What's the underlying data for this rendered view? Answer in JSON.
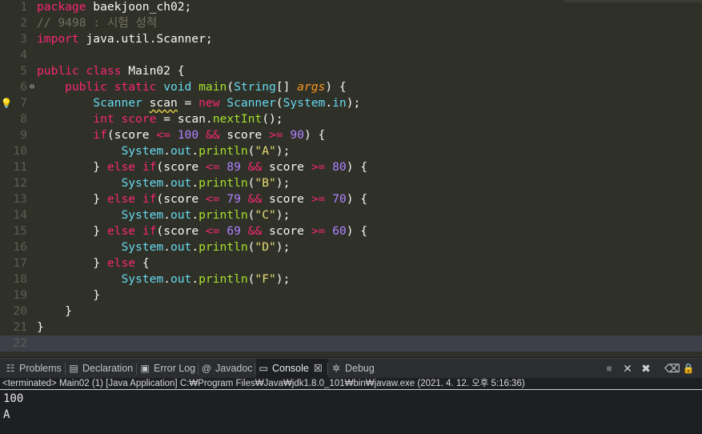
{
  "editor": {
    "lines": [
      [
        {
          "t": "package",
          "c": "kw"
        },
        {
          "t": " baekjoon_ch02;",
          "c": "pl"
        }
      ],
      [
        {
          "t": "// 9498 : 시험 성적",
          "c": "cm"
        }
      ],
      [
        {
          "t": "import",
          "c": "kw"
        },
        {
          "t": " java.util.Scanner;",
          "c": "pl"
        }
      ],
      [],
      [
        {
          "t": "public",
          "c": "kw"
        },
        {
          "t": " ",
          "c": "pl"
        },
        {
          "t": "class",
          "c": "kw"
        },
        {
          "t": " Main02 {",
          "c": "pl"
        }
      ],
      [
        {
          "t": "    ",
          "c": "pl"
        },
        {
          "t": "public",
          "c": "kw"
        },
        {
          "t": " ",
          "c": "pl"
        },
        {
          "t": "static",
          "c": "kw"
        },
        {
          "t": " ",
          "c": "pl"
        },
        {
          "t": "void",
          "c": "ty"
        },
        {
          "t": " ",
          "c": "pl"
        },
        {
          "t": "main",
          "c": "fn"
        },
        {
          "t": "(",
          "c": "pl"
        },
        {
          "t": "String",
          "c": "ty"
        },
        {
          "t": "[] ",
          "c": "pl"
        },
        {
          "t": "args",
          "c": "pa"
        },
        {
          "t": ") {",
          "c": "pl"
        }
      ],
      [
        {
          "t": "        ",
          "c": "pl"
        },
        {
          "t": "Scanner",
          "c": "ty"
        },
        {
          "t": " ",
          "c": "pl"
        },
        {
          "t": "scan",
          "c": "pl warn"
        },
        {
          "t": " = ",
          "c": "pl"
        },
        {
          "t": "new",
          "c": "kw"
        },
        {
          "t": " ",
          "c": "pl"
        },
        {
          "t": "Scanner",
          "c": "ty"
        },
        {
          "t": "(",
          "c": "pl"
        },
        {
          "t": "System",
          "c": "ty"
        },
        {
          "t": ".",
          "c": "pl"
        },
        {
          "t": "in",
          "c": "ty"
        },
        {
          "t": ");",
          "c": "pl"
        }
      ],
      [
        {
          "t": "        ",
          "c": "pl"
        },
        {
          "t": "int",
          "c": "kw"
        },
        {
          "t": " ",
          "c": "pl"
        },
        {
          "t": "score",
          "c": "kw"
        },
        {
          "t": " = scan.",
          "c": "pl"
        },
        {
          "t": "nextInt",
          "c": "fn"
        },
        {
          "t": "();",
          "c": "pl"
        }
      ],
      [
        {
          "t": "        ",
          "c": "pl"
        },
        {
          "t": "if",
          "c": "kw"
        },
        {
          "t": "(score ",
          "c": "pl"
        },
        {
          "t": "<=",
          "c": "kw"
        },
        {
          "t": " ",
          "c": "pl"
        },
        {
          "t": "100",
          "c": "num"
        },
        {
          "t": " ",
          "c": "pl"
        },
        {
          "t": "&&",
          "c": "kw"
        },
        {
          "t": " score ",
          "c": "pl"
        },
        {
          "t": ">=",
          "c": "kw"
        },
        {
          "t": " ",
          "c": "pl"
        },
        {
          "t": "90",
          "c": "num"
        },
        {
          "t": ") {",
          "c": "pl"
        }
      ],
      [
        {
          "t": "            ",
          "c": "pl"
        },
        {
          "t": "System",
          "c": "ty"
        },
        {
          "t": ".",
          "c": "pl"
        },
        {
          "t": "out",
          "c": "ty"
        },
        {
          "t": ".",
          "c": "pl"
        },
        {
          "t": "println",
          "c": "fn"
        },
        {
          "t": "(",
          "c": "pl"
        },
        {
          "t": "\"A\"",
          "c": "str"
        },
        {
          "t": ");",
          "c": "pl"
        }
      ],
      [
        {
          "t": "        } ",
          "c": "pl"
        },
        {
          "t": "else",
          "c": "kw"
        },
        {
          "t": " ",
          "c": "pl"
        },
        {
          "t": "if",
          "c": "kw"
        },
        {
          "t": "(score ",
          "c": "pl"
        },
        {
          "t": "<=",
          "c": "kw"
        },
        {
          "t": " ",
          "c": "pl"
        },
        {
          "t": "89",
          "c": "num"
        },
        {
          "t": " ",
          "c": "pl"
        },
        {
          "t": "&&",
          "c": "kw"
        },
        {
          "t": " score ",
          "c": "pl"
        },
        {
          "t": ">=",
          "c": "kw"
        },
        {
          "t": " ",
          "c": "pl"
        },
        {
          "t": "80",
          "c": "num"
        },
        {
          "t": ") {",
          "c": "pl"
        }
      ],
      [
        {
          "t": "            ",
          "c": "pl"
        },
        {
          "t": "System",
          "c": "ty"
        },
        {
          "t": ".",
          "c": "pl"
        },
        {
          "t": "out",
          "c": "ty"
        },
        {
          "t": ".",
          "c": "pl"
        },
        {
          "t": "println",
          "c": "fn"
        },
        {
          "t": "(",
          "c": "pl"
        },
        {
          "t": "\"B\"",
          "c": "str"
        },
        {
          "t": ");",
          "c": "pl"
        }
      ],
      [
        {
          "t": "        } ",
          "c": "pl"
        },
        {
          "t": "else",
          "c": "kw"
        },
        {
          "t": " ",
          "c": "pl"
        },
        {
          "t": "if",
          "c": "kw"
        },
        {
          "t": "(score ",
          "c": "pl"
        },
        {
          "t": "<=",
          "c": "kw"
        },
        {
          "t": " ",
          "c": "pl"
        },
        {
          "t": "79",
          "c": "num"
        },
        {
          "t": " ",
          "c": "pl"
        },
        {
          "t": "&&",
          "c": "kw"
        },
        {
          "t": " score ",
          "c": "pl"
        },
        {
          "t": ">=",
          "c": "kw"
        },
        {
          "t": " ",
          "c": "pl"
        },
        {
          "t": "70",
          "c": "num"
        },
        {
          "t": ") {",
          "c": "pl"
        }
      ],
      [
        {
          "t": "            ",
          "c": "pl"
        },
        {
          "t": "System",
          "c": "ty"
        },
        {
          "t": ".",
          "c": "pl"
        },
        {
          "t": "out",
          "c": "ty"
        },
        {
          "t": ".",
          "c": "pl"
        },
        {
          "t": "println",
          "c": "fn"
        },
        {
          "t": "(",
          "c": "pl"
        },
        {
          "t": "\"C\"",
          "c": "str"
        },
        {
          "t": ");",
          "c": "pl"
        }
      ],
      [
        {
          "t": "        } ",
          "c": "pl"
        },
        {
          "t": "else",
          "c": "kw"
        },
        {
          "t": " ",
          "c": "pl"
        },
        {
          "t": "if",
          "c": "kw"
        },
        {
          "t": "(score ",
          "c": "pl"
        },
        {
          "t": "<=",
          "c": "kw"
        },
        {
          "t": " ",
          "c": "pl"
        },
        {
          "t": "69",
          "c": "num"
        },
        {
          "t": " ",
          "c": "pl"
        },
        {
          "t": "&&",
          "c": "kw"
        },
        {
          "t": " score ",
          "c": "pl"
        },
        {
          "t": ">=",
          "c": "kw"
        },
        {
          "t": " ",
          "c": "pl"
        },
        {
          "t": "60",
          "c": "num"
        },
        {
          "t": ") {",
          "c": "pl"
        }
      ],
      [
        {
          "t": "            ",
          "c": "pl"
        },
        {
          "t": "System",
          "c": "ty"
        },
        {
          "t": ".",
          "c": "pl"
        },
        {
          "t": "out",
          "c": "ty"
        },
        {
          "t": ".",
          "c": "pl"
        },
        {
          "t": "println",
          "c": "fn"
        },
        {
          "t": "(",
          "c": "pl"
        },
        {
          "t": "\"D\"",
          "c": "str"
        },
        {
          "t": ");",
          "c": "pl"
        }
      ],
      [
        {
          "t": "        } ",
          "c": "pl"
        },
        {
          "t": "else",
          "c": "kw"
        },
        {
          "t": " {",
          "c": "pl"
        }
      ],
      [
        {
          "t": "            ",
          "c": "pl"
        },
        {
          "t": "System",
          "c": "ty"
        },
        {
          "t": ".",
          "c": "pl"
        },
        {
          "t": "out",
          "c": "ty"
        },
        {
          "t": ".",
          "c": "pl"
        },
        {
          "t": "println",
          "c": "fn"
        },
        {
          "t": "(",
          "c": "pl"
        },
        {
          "t": "\"F\"",
          "c": "str"
        },
        {
          "t": ");",
          "c": "pl"
        }
      ],
      [
        {
          "t": "        }",
          "c": "pl"
        }
      ],
      [
        {
          "t": "    }",
          "c": "pl"
        }
      ],
      [
        {
          "t": "}",
          "c": "pl"
        }
      ],
      []
    ],
    "current_line": 22,
    "fold_marker_line": 6,
    "bulb_line": 7,
    "fold_glyph": "⊖",
    "bulb_glyph": "💡"
  },
  "console_panel": {
    "tabs": [
      {
        "label": "Problems",
        "icon": "problems-icon",
        "glyph": "☷",
        "active": false
      },
      {
        "label": "Declaration",
        "icon": "declaration-icon",
        "glyph": "▤",
        "active": false
      },
      {
        "label": "Error Log",
        "icon": "error-log-icon",
        "glyph": "▣",
        "active": false
      },
      {
        "label": "Javadoc",
        "icon": "javadoc-icon",
        "glyph": "@",
        "active": false
      },
      {
        "label": "Console",
        "icon": "console-icon",
        "glyph": "▭",
        "active": true,
        "close": "☒"
      },
      {
        "label": "Debug",
        "icon": "debug-icon",
        "glyph": "✲",
        "active": false
      }
    ],
    "toolbar": [
      {
        "name": "terminate-icon",
        "glyph": "■"
      },
      {
        "name": "remove-launch-icon",
        "glyph": "✕"
      },
      {
        "name": "remove-all-terminated-icon",
        "glyph": "✖"
      },
      {
        "name": "clear-console-icon",
        "glyph": "⌫"
      },
      {
        "name": "scroll-lock-icon",
        "glyph": "🔒"
      }
    ],
    "status": "<terminated> Main02 (1) [Java Application] C:₩Program Files₩Java₩jdk1.8.0_101₩bin₩javaw.exe (2021. 4. 12. 오후 5:16:36)",
    "output": [
      "100",
      "A"
    ]
  }
}
